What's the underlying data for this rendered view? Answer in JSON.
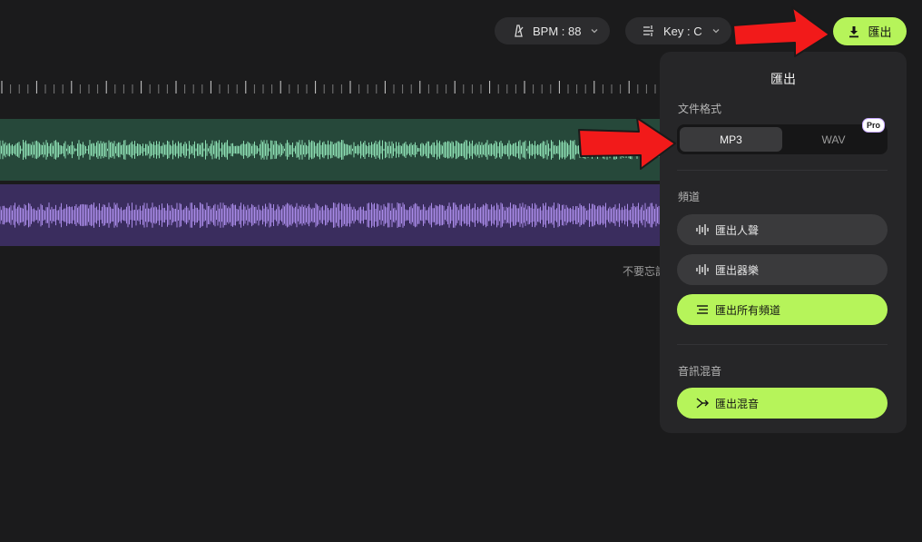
{
  "toolbar": {
    "bpm_label": "BPM : 88",
    "key_label": "Key : C",
    "export_label": "匯出",
    "icons": {
      "bpm": "metronome-icon",
      "key": "tuning-fork-icon",
      "export": "download-icon",
      "chevron": "chevron-down-icon"
    }
  },
  "workspace": {
    "hint_text": "不要忘記"
  },
  "export_panel": {
    "title": "匯出",
    "format_section_label": "文件格式",
    "format_options": [
      "MP3",
      "WAV"
    ],
    "selected_format": "MP3",
    "pro_badge": "Pro",
    "channels_section_label": "頻道",
    "channel_actions": [
      {
        "label": "匯出人聲",
        "icon": "waveform-icon"
      },
      {
        "label": "匯出器樂",
        "icon": "waveform-icon"
      },
      {
        "label": "匯出所有頻道",
        "icon": "lines-icon"
      }
    ],
    "mix_section_label": "音訊混音",
    "mix_action": {
      "label": "匯出混音",
      "icon": "merge-icon"
    }
  },
  "colors": {
    "accent": "#b6f45a",
    "background": "#1b1b1c",
    "panel": "#262628",
    "vocal_track": "#26483a",
    "vocal_wave": "#8ee0b4",
    "instrument_track": "#3a2d5e",
    "instrument_wave": "#a98be8",
    "annotation_arrow": "#f21a1a"
  }
}
